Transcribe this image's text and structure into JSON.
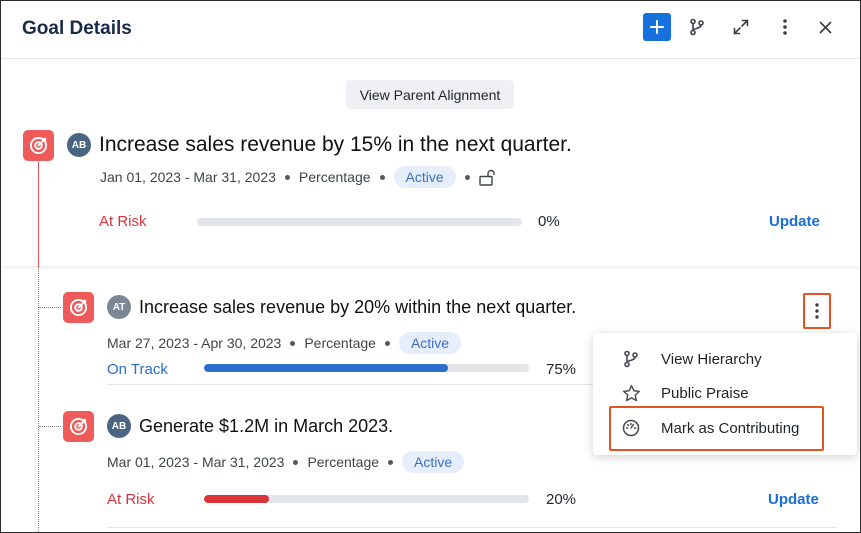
{
  "header": {
    "title": "Goal Details",
    "icons": [
      "plus-icon",
      "branch-icon",
      "expand-icon",
      "more-vertical-icon",
      "close-icon"
    ]
  },
  "parent_alignment_label": "View Parent Alignment",
  "parent_goal": {
    "avatar": "AB",
    "title": "Increase sales revenue by 15% in the next quarter.",
    "dates": "Jan 01, 2023 - Mar 31, 2023",
    "type": "Percentage",
    "state": "Active",
    "status": "At Risk",
    "progress_label": "0%",
    "progress": 0,
    "update_label": "Update"
  },
  "child_goals": [
    {
      "avatar": "AT",
      "title": "Increase sales revenue by 20% within the next quarter.",
      "dates": "Mar 27, 2023 - Apr 30, 2023",
      "type": "Percentage",
      "state": "Active",
      "status": "On Track",
      "progress_label": "75%",
      "progress": 75
    },
    {
      "avatar": "AB",
      "title": "Generate $1.2M in March 2023.",
      "dates": "Mar 01, 2023 - Mar 31, 2023",
      "type": "Percentage",
      "state": "Active",
      "status": "At Risk",
      "progress_label": "20%",
      "progress": 20,
      "update_label": "Update"
    }
  ],
  "context_menu": {
    "items": [
      {
        "label": "View Hierarchy",
        "icon": "branch-icon"
      },
      {
        "label": "Public Praise",
        "icon": "star-icon"
      },
      {
        "label": "Mark as Contributing",
        "icon": "gauge-icon"
      }
    ]
  },
  "colors": {
    "accent": "#1671dc",
    "at_risk": "#d9343a",
    "on_track": "#2c6ecb",
    "goal_icon": "#ef5b5b",
    "highlight": "#e25522"
  }
}
